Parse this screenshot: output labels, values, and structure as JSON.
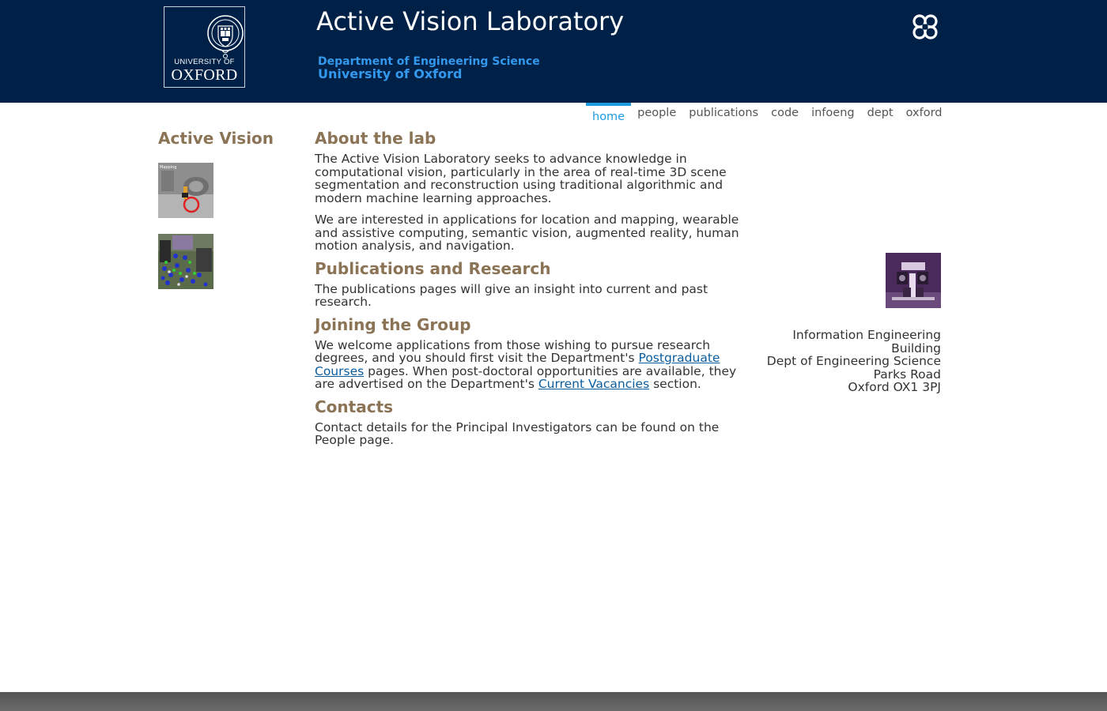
{
  "header": {
    "logo": {
      "university_of": "UNIVERSITY OF",
      "oxford": "OXFORD"
    },
    "title": "Active Vision Laboratory",
    "department": "Department of Engineering Science",
    "university": "University of Oxford",
    "icon": "clover-knot-icon",
    "background_color": "#002147",
    "accent_color": "#3399ee"
  },
  "nav": {
    "items": [
      {
        "label": "home",
        "active": true
      },
      {
        "label": "people",
        "active": false
      },
      {
        "label": "publications",
        "active": false
      },
      {
        "label": "code",
        "active": false
      },
      {
        "label": "infoeng",
        "active": false
      },
      {
        "label": "dept",
        "active": false
      },
      {
        "label": "oxford",
        "active": false
      }
    ],
    "active_color": "#1e9be0"
  },
  "sidebar": {
    "title": "Active Vision",
    "thumbnails": [
      {
        "caption": "Mapping"
      },
      {
        "caption": ""
      }
    ]
  },
  "main": {
    "about": {
      "heading": "About the lab",
      "p1": "The Active Vision Laboratory seeks to advance knowledge in computational vision, particularly in the area of real-time 3D scene segmentation and reconstruction using traditional algorithmic and modern machine learning approaches.",
      "p2": "We are interested in applications for location and mapping, wearable and assistive computing, semantic vision, augmented reality, human motion analysis, and navigation."
    },
    "publications": {
      "heading": "Publications and Research",
      "p1": "The publications pages will give an insight into current and past research."
    },
    "joining": {
      "heading": "Joining the Group",
      "text1": "We welcome applications from those wishing to pursue research degrees, and you should first visit the Department's ",
      "link1": "Postgraduate Courses",
      "text2": " pages. When post-doctoral opportunities are available, they are advertised on the Department's ",
      "link2": "Current Vacancies",
      "text3": " section."
    },
    "contacts": {
      "heading": "Contacts",
      "p1": "Contact details for the Principal Investigators can be found on the People page."
    },
    "heading_color": "#8b7355",
    "link_color": "#0a5c9c"
  },
  "address": {
    "line1": "Information Engineering Building",
    "line2": "Dept of Engineering Science",
    "line3": "Parks Road",
    "line4": "Oxford OX1 3PJ"
  }
}
